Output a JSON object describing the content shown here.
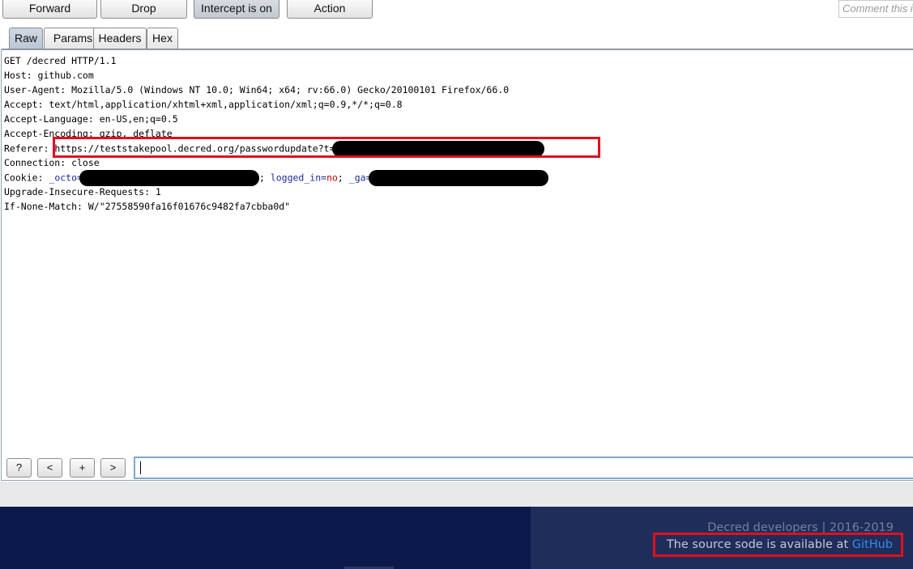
{
  "toolbar": {
    "forward": "Forward",
    "drop": "Drop",
    "intercept": "Intercept is on",
    "action": "Action",
    "comment_placeholder": "Comment this i"
  },
  "tabs": [
    "Raw",
    "Params",
    "Headers",
    "Hex"
  ],
  "request": {
    "line1": "GET /decred HTTP/1.1",
    "host": "Host: github.com",
    "user_agent": "User-Agent: Mozilla/5.0 (Windows NT 10.0; Win64; x64; rv:66.0) Gecko/20100101 Firefox/66.0",
    "accept": "Accept: text/html,application/xhtml+xml,application/xml;q=0.9,*/*;q=0.8",
    "accept_language": "Accept-Language: en-US,en;q=0.5",
    "accept_encoding": "Accept-Encoding: gzip, deflate",
    "referer_label": "Referer: ",
    "referer_url": "https://teststakepool.decred.org/passwordupdate?t=1",
    "connection": "Connection: close",
    "cookie_label": "Cookie: ",
    "cookie_octo": "_octo",
    "cookie_eq1": "=",
    "cookie_sep": "; ",
    "cookie_logged_in": "logged_in",
    "cookie_eq2": "=",
    "cookie_no": "no",
    "cookie_sep2": "; ",
    "cookie_ga": "_ga",
    "cookie_eq3": "=",
    "upgrade": "Upgrade-Insecure-Requests: 1",
    "if_none_match": "If-None-Match: W/\"27558590fa16f01676c9482fa7cbba0d\""
  },
  "controls": {
    "help": "?",
    "prev": "<",
    "add": "+",
    "next": ">"
  },
  "footer": {
    "copyright": "Decred developers | 2016-2019",
    "source_text": "The source sode is available at ",
    "source_link": "GitHub"
  },
  "colors": {
    "highlight_box": "#e0101c",
    "footer_bg": "#0c1a4b",
    "link": "#2e8ff0"
  }
}
